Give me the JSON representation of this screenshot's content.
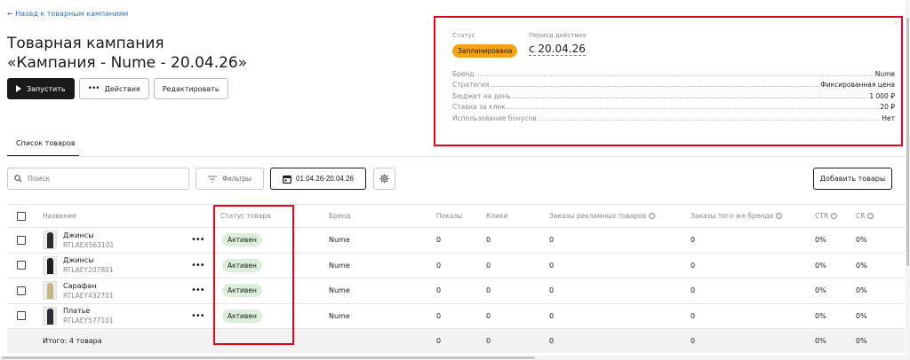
{
  "header": {
    "back_link": "← Назад к товарным кампаниям",
    "title_line1": "Товарная кампания",
    "title_line2": "«Кампания - Nume - 20.04.26»"
  },
  "actions": {
    "start": "Запустить",
    "more": "Действия",
    "edit": "Редактировать"
  },
  "info": {
    "status_label": "Статус",
    "status_value": "Запланирована",
    "period_label": "Период действия",
    "period_value": "с 20.04.26",
    "rows": [
      {
        "key": "Бренд",
        "value": "Nume"
      },
      {
        "key": "Стратегия",
        "value": "Фиксированная цена"
      },
      {
        "key": "Бюджет на день",
        "value": "1 000 ₽"
      },
      {
        "key": "Ставка за клик",
        "value": "20 ₽"
      },
      {
        "key": "Использование бонусов",
        "value": "Нет"
      }
    ]
  },
  "tabs": {
    "products": "Список товаров"
  },
  "toolbar": {
    "search_placeholder": "Поиск",
    "filters": "Фильтры",
    "date_range": "01.04.26-20.04.26",
    "add_products": "Добавить товары"
  },
  "table": {
    "columns": {
      "name": "Название",
      "status": "Статус товара",
      "brand": "Бренд",
      "shows": "Показы",
      "clicks": "Клики",
      "ad_orders": "Заказы рекламных товаров",
      "brand_orders": "Заказы того же бренда",
      "ctr": "CTR",
      "cr": "CR"
    },
    "rows": [
      {
        "name": "Джинсы",
        "sku": "RTLAEX563101",
        "status": "Активен",
        "brand": "Nume",
        "shows": "0",
        "clicks": "0",
        "ad_orders": "0",
        "brand_orders": "0",
        "ctr": "0%",
        "cr": "0%",
        "thumb_color": "#2a2a2a"
      },
      {
        "name": "Джинсы",
        "sku": "RTLAEY207801",
        "status": "Активен",
        "brand": "Nume",
        "shows": "0",
        "clicks": "0",
        "ad_orders": "0",
        "brand_orders": "0",
        "ctr": "0%",
        "cr": "0%",
        "thumb_color": "#1e1e1e"
      },
      {
        "name": "Сарафан",
        "sku": "RTLAEY432701",
        "status": "Активен",
        "brand": "Nume",
        "shows": "0",
        "clicks": "0",
        "ad_orders": "0",
        "brand_orders": "0",
        "ctr": "0%",
        "cr": "0%",
        "thumb_color": "#c9b48a"
      },
      {
        "name": "Платье",
        "sku": "RTLAEY577101",
        "status": "Активен",
        "brand": "Nume",
        "shows": "0",
        "clicks": "0",
        "ad_orders": "0",
        "brand_orders": "0",
        "ctr": "0%",
        "cr": "0%",
        "thumb_color": "#2d2d36"
      }
    ],
    "total": {
      "label": "Итого: 4 товара",
      "shows": "0",
      "clicks": "0",
      "ad_orders": "0",
      "brand_orders": "0",
      "ctr": "0%",
      "cr": "0%"
    }
  },
  "colors": {
    "planned_badge": "#f5a21b",
    "active_badge": "#dcefdc",
    "highlight": "#e8001c",
    "link": "#2f6fd6"
  }
}
